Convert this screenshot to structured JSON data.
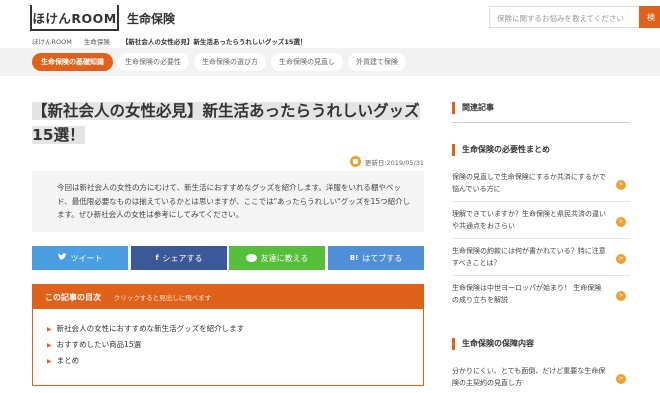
{
  "header": {
    "logo_text": "ほけんROOM",
    "site_title": "生命保険",
    "search_placeholder": "保険に関するお悩みを教えてください",
    "search_button": "検"
  },
  "breadcrumb": [
    "ほけんROOM",
    "生命保険",
    "【新社会人の女性必見】新生活あったらうれしいグッズ15選！"
  ],
  "tabs": [
    {
      "label": "生命保険の基礎知識",
      "active": true
    },
    {
      "label": "生命保険の必要性",
      "active": false
    },
    {
      "label": "生命保険の選び方",
      "active": false
    },
    {
      "label": "生命保険の見直し",
      "active": false
    },
    {
      "label": "外貨建て保険",
      "active": false
    }
  ],
  "article": {
    "title": "【新社会人の女性必見】新生活あったらうれしいグッズ15選！",
    "updated": "更新日:2019/05/31",
    "intro": "今回は新社会人の女性の方にむけて、新生活におすすめなグッズを紹介します。洋服をいれる棚やベッド、最低限必要なものは揃えているかとは思いますが、ここでは\"あったらうれしい\"グッズを15つ紹介します。ぜひ新社会人の女性は参考にしてみてください。"
  },
  "share": {
    "twitter": "ツイート",
    "facebook": "シェアする",
    "line": "友達に教える",
    "hatena": "はてブする",
    "hatena_icon": "B!",
    "facebook_icon": "f"
  },
  "toc": {
    "title": "この記事の目次",
    "hint": "クリックすると見出しに飛べます",
    "items": [
      "新社会人の女性におすすめな新生活グッズを紹介します",
      "おすすめしたい商品15選",
      "まとめ"
    ]
  },
  "sidebar": {
    "related_heading": "関連記事",
    "section1": {
      "heading": "生命保険の必要性まとめ",
      "items": [
        "保険の見直しで生命保険にするか共済にするかで悩んでいる方に",
        "理解できていますか？生命保険と県民共済の違いや共通点をおさらい",
        "生命保険の約款には何が書かれている？特に注意すべきことは？",
        "生命保険は中世ヨーロッパが始まり！ 生命保険の成り立ちを解説"
      ]
    },
    "section2": {
      "heading": "生命保険の保障内容",
      "items": [
        "分かりにくい、とても面倒、だけど重要な生命保険の主契約の見直し方"
      ]
    }
  },
  "colors": {
    "accent": "#e0621a",
    "twitter": "#4b9fe1",
    "facebook": "#3b5998",
    "line": "#55bf3a",
    "hatena": "#4e8fd8"
  }
}
